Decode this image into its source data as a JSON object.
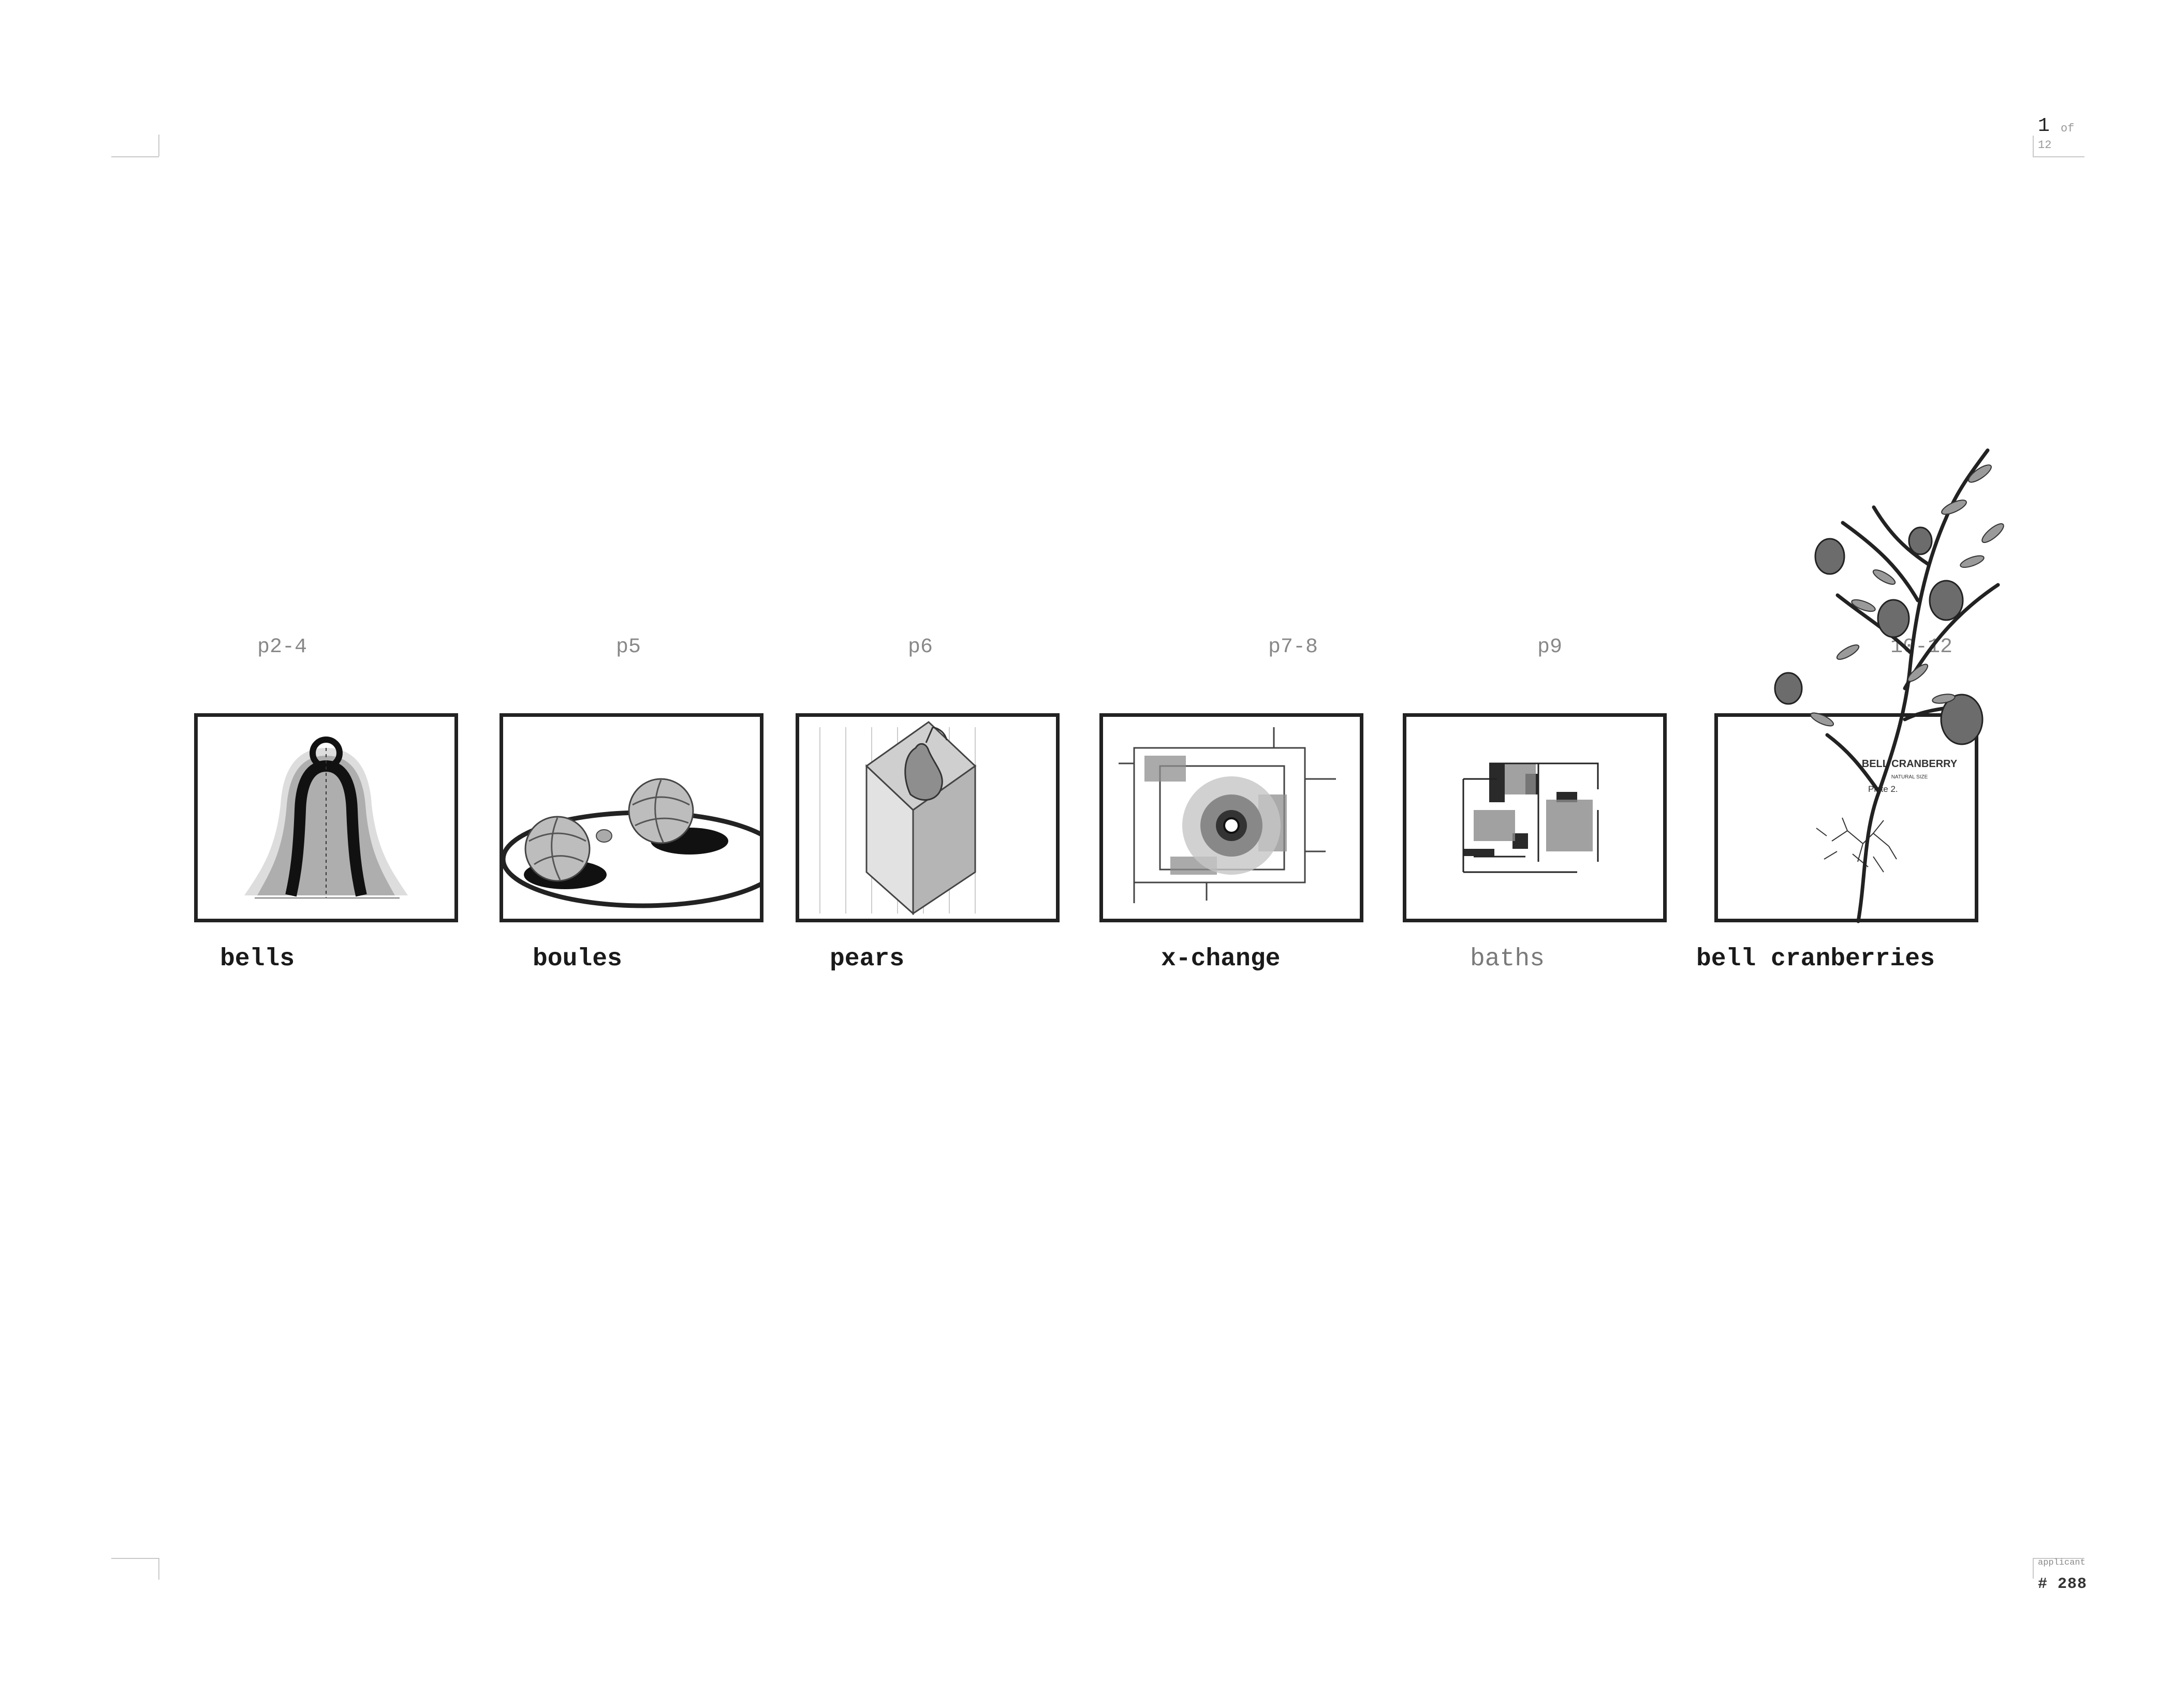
{
  "page": {
    "current": "1",
    "of_label": "of",
    "total": "12"
  },
  "applicant": {
    "label": "applicant",
    "number": "# 288"
  },
  "items": [
    {
      "ref": "p2-4",
      "caption": "bells",
      "icon": "bell-drawing"
    },
    {
      "ref": "p5",
      "caption": "boules",
      "icon": "boules-drawing"
    },
    {
      "ref": "p6",
      "caption": "pears",
      "icon": "pear-box-drawing"
    },
    {
      "ref": "p7-8",
      "caption": "x-change",
      "icon": "x-change-plan-drawing"
    },
    {
      "ref": "p9",
      "caption": "baths",
      "icon": "baths-plan-drawing"
    },
    {
      "ref": "10-12",
      "caption": "bell cranberries",
      "icon": "cranberry-botanical-drawing"
    }
  ],
  "botanical_plate": {
    "title": "BELL CRANBERRY",
    "subtitle": "NATURAL SIZE",
    "plate": "Plate 2."
  },
  "colors": {
    "ink": "#222222",
    "caption": "#1a1a1a",
    "ref": "#888888",
    "mark": "#c8c8c8"
  }
}
